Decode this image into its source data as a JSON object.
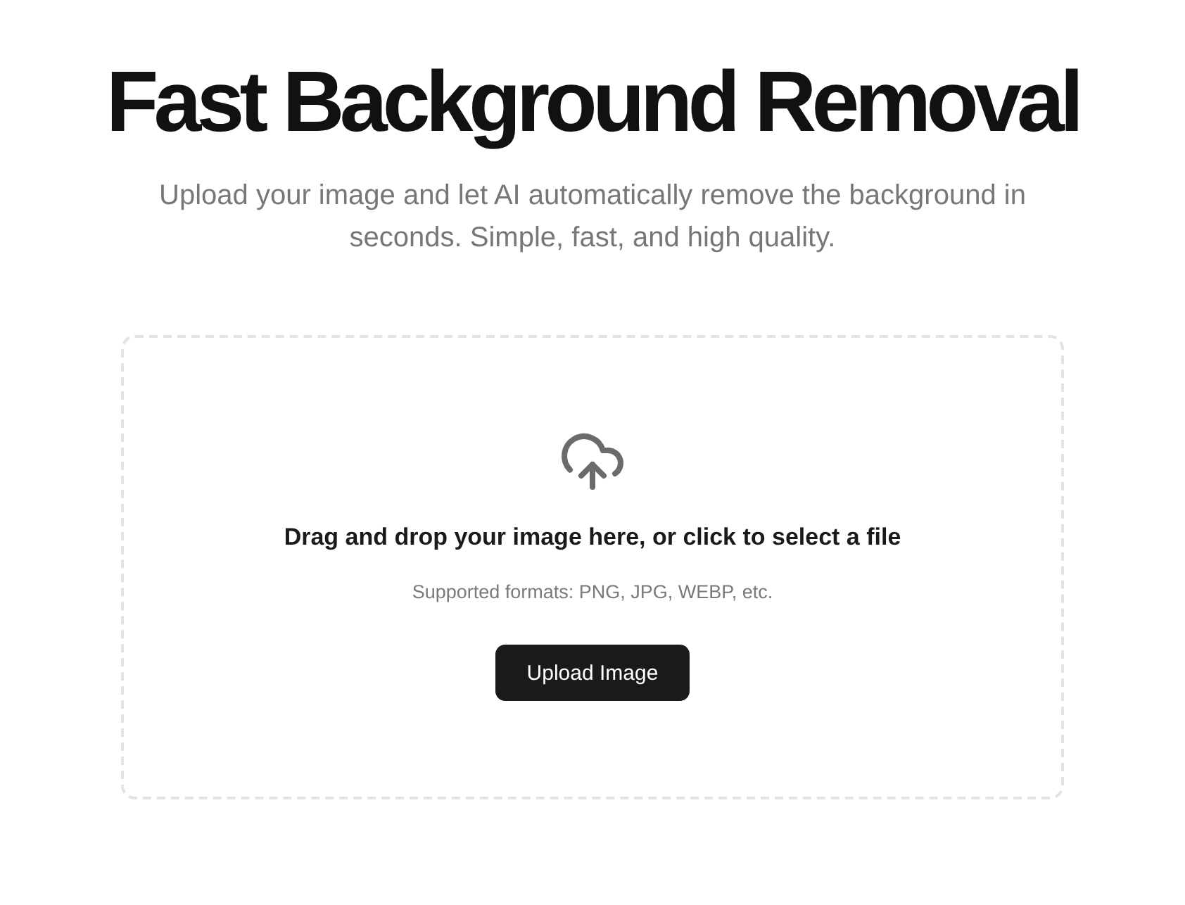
{
  "header": {
    "title": "Fast Background Removal",
    "subtitle": "Upload your image and let AI automatically remove the background in seconds. Simple, fast, and high quality."
  },
  "dropzone": {
    "instruction": "Drag and drop your image here, or click to select a file",
    "formats": "Supported formats: PNG, JPG, WEBP, etc.",
    "button": "Upload Image"
  }
}
